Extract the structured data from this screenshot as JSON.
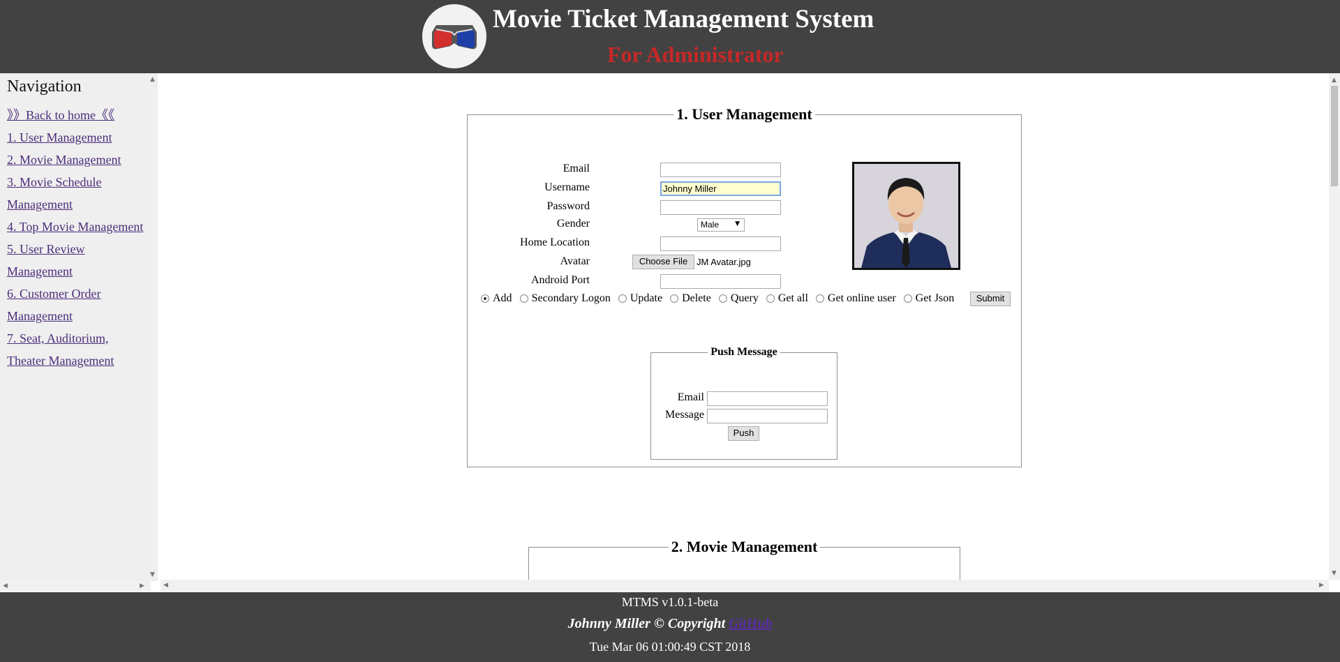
{
  "header": {
    "title": "Movie Ticket Management System",
    "subtitle": "For Administrator",
    "logo_icon": "3d-glasses-icon"
  },
  "sidebar": {
    "heading": "Navigation",
    "items": [
      {
        "label": "》》Back to home《《"
      },
      {
        "label": "1. User Management"
      },
      {
        "label": "2. Movie Management"
      },
      {
        "label": "3. Movie Schedule Management"
      },
      {
        "label": "4. Top Movie Management"
      },
      {
        "label": "5. User Review Management"
      },
      {
        "label": "6. Customer Order Management"
      },
      {
        "label": "7. Seat, Auditorium, Theater Management"
      }
    ]
  },
  "user_management": {
    "legend": "1. User Management",
    "fields": {
      "email": {
        "label": "Email",
        "value": ""
      },
      "username": {
        "label": "Username",
        "value": "Johnny Miller"
      },
      "password": {
        "label": "Password",
        "value": ""
      },
      "gender": {
        "label": "Gender",
        "value": "Male"
      },
      "home_location": {
        "label": "Home Location",
        "value": ""
      },
      "avatar": {
        "label": "Avatar",
        "button": "Choose File",
        "file": "JM Avatar.jpg"
      },
      "android_port": {
        "label": "Android Port",
        "value": ""
      }
    },
    "actions": [
      {
        "label": "Add",
        "checked": true
      },
      {
        "label": "Secondary Logon",
        "checked": false
      },
      {
        "label": "Update",
        "checked": false
      },
      {
        "label": "Delete",
        "checked": false
      },
      {
        "label": "Query",
        "checked": false
      },
      {
        "label": "Get all",
        "checked": false
      },
      {
        "label": "Get online user",
        "checked": false
      },
      {
        "label": "Get Json",
        "checked": false
      }
    ],
    "submit_label": "Submit"
  },
  "push_message": {
    "legend": "Push Message",
    "email_label": "Email",
    "email_value": "",
    "message_label": "Message",
    "message_value": "",
    "push_label": "Push"
  },
  "movie_management": {
    "legend": "2. Movie Management"
  },
  "footer": {
    "version": "MTMS v1.0.1-beta",
    "copyright": "Johnny Miller © Copyright",
    "github_label": "GitHub",
    "datetime": "Tue Mar 06 01:00:49 CST 2018"
  },
  "colors": {
    "header_bg": "#424242",
    "subtitle": "#c62828",
    "link": "#4a2d7a",
    "sidebar_bg": "#efefef"
  }
}
